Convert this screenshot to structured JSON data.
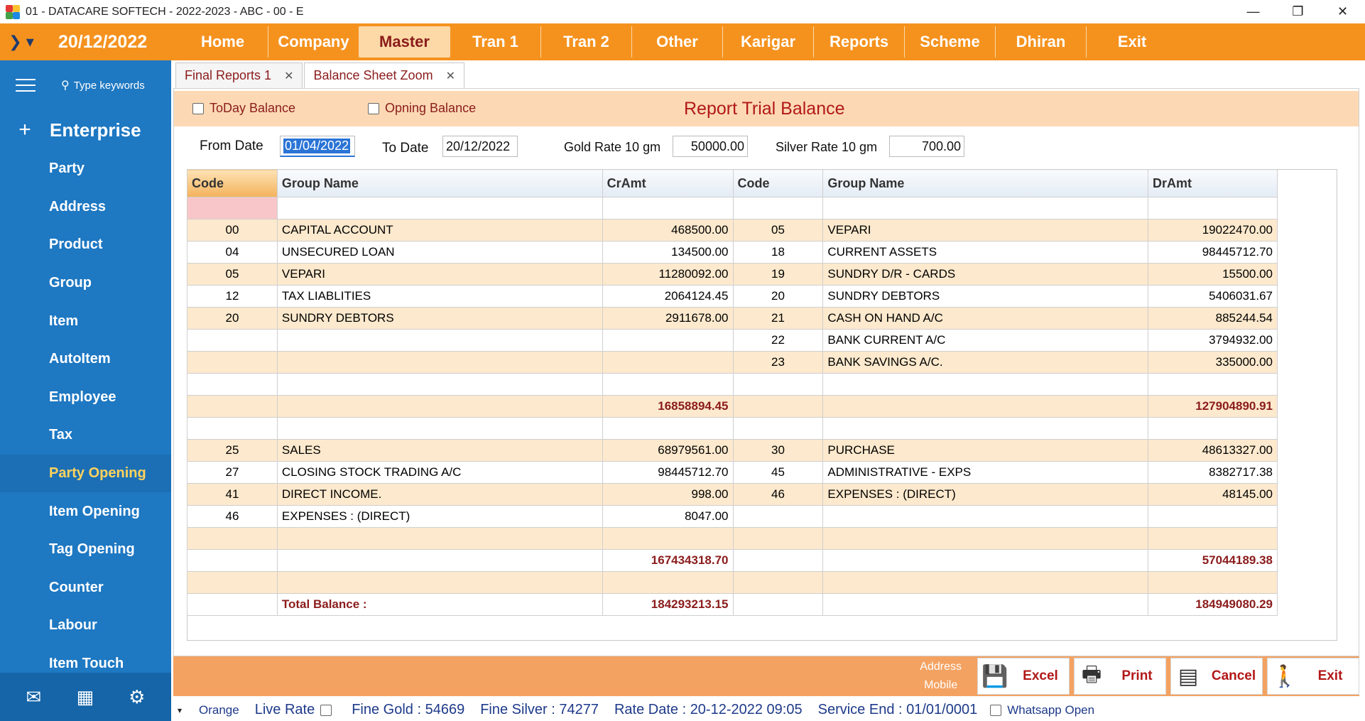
{
  "window": {
    "title": "01 - DATACARE SOFTECH - 2022-2023 - ABC - 00 - E",
    "min": "—",
    "restore": "❐",
    "close": "✕"
  },
  "menubar": {
    "toggle": "❯ ▾",
    "date": "20/12/2022",
    "items": [
      "Home",
      "Company",
      "Master",
      "Tran 1",
      "Tran 2",
      "Other",
      "Karigar",
      "Reports",
      "Scheme",
      "Dhiran",
      "Exit"
    ],
    "active": "Master"
  },
  "sidebar": {
    "search_placeholder": "Type keywords",
    "heading": "Enterprise",
    "plus": "+",
    "items": [
      "Party",
      "Address",
      "Product",
      "Group",
      "Item",
      "AutoItem",
      "Employee",
      "Tax",
      "Party Opening",
      "Item Opening",
      "Tag Opening",
      "Counter",
      "Labour",
      "Item Touch"
    ],
    "active": "Party Opening",
    "bottom_icons": [
      "mail-icon",
      "calendar-icon",
      "user-settings-icon"
    ]
  },
  "tabs": [
    {
      "label": "Final Reports 1",
      "close": "✕"
    },
    {
      "label": "Balance Sheet Zoom",
      "close": "✕"
    }
  ],
  "options": {
    "today_balance": "ToDay Balance",
    "opening_balance": "Opning Balance",
    "report_title": "Report Trial Balance"
  },
  "filters": {
    "from_date_label": "From Date",
    "from_date": "01/04/2022",
    "to_date_label": "To Date",
    "to_date": "20/12/2022",
    "gold_rate_label": "Gold Rate 10 gm",
    "gold_rate": "50000.00",
    "silver_rate_label": "Silver Rate 10 gm",
    "silver_rate": "700.00"
  },
  "grid": {
    "headers": [
      "Code",
      "Group Name",
      "CrAmt",
      "Code",
      "Group Name",
      "DrAmt"
    ],
    "rows": [
      {
        "cells": [
          "",
          "",
          "",
          "",
          "",
          ""
        ],
        "style": "plain",
        "first": true
      },
      {
        "cells": [
          "00",
          "CAPITAL ACCOUNT",
          "468500.00",
          "05",
          "VEPARI",
          "19022470.00"
        ],
        "style": "alt"
      },
      {
        "cells": [
          "04",
          "UNSECURED LOAN",
          "134500.00",
          "18",
          "CURRENT ASSETS",
          "98445712.70"
        ],
        "style": "plain"
      },
      {
        "cells": [
          "05",
          "VEPARI",
          "11280092.00",
          "19",
          "SUNDRY D/R - CARDS",
          "15500.00"
        ],
        "style": "alt"
      },
      {
        "cells": [
          "12",
          "TAX LIABLITIES",
          "2064124.45",
          "20",
          "SUNDRY DEBTORS",
          "5406031.67"
        ],
        "style": "plain"
      },
      {
        "cells": [
          "20",
          "SUNDRY DEBTORS",
          "2911678.00",
          "21",
          "CASH ON HAND A/C",
          "885244.54"
        ],
        "style": "alt"
      },
      {
        "cells": [
          "",
          "",
          "",
          "22",
          "BANK CURRENT A/C",
          "3794932.00"
        ],
        "style": "plain"
      },
      {
        "cells": [
          "",
          "",
          "",
          "23",
          "BANK SAVINGS A/C.",
          "335000.00"
        ],
        "style": "alt"
      },
      {
        "cells": [
          "",
          "",
          "",
          "",
          "",
          ""
        ],
        "style": "plain"
      },
      {
        "cells": [
          "",
          "",
          "16858894.45",
          "",
          "",
          "127904890.91"
        ],
        "style": "alt",
        "total": true
      },
      {
        "cells": [
          "",
          "",
          "",
          "",
          "",
          ""
        ],
        "style": "plain"
      },
      {
        "cells": [
          "25",
          "SALES",
          "68979561.00",
          "30",
          "PURCHASE",
          "48613327.00"
        ],
        "style": "alt"
      },
      {
        "cells": [
          "27",
          "CLOSING STOCK TRADING A/C",
          "98445712.70",
          "45",
          "ADMINISTRATIVE - EXPS",
          "8382717.38"
        ],
        "style": "plain"
      },
      {
        "cells": [
          "41",
          "DIRECT INCOME.",
          "998.00",
          "46",
          "EXPENSES : (DIRECT)",
          "48145.00"
        ],
        "style": "alt"
      },
      {
        "cells": [
          "46",
          "EXPENSES : (DIRECT)",
          "8047.00",
          "",
          "",
          ""
        ],
        "style": "plain"
      },
      {
        "cells": [
          "",
          "",
          "",
          "",
          "",
          ""
        ],
        "style": "alt"
      },
      {
        "cells": [
          "",
          "",
          "167434318.70",
          "",
          "",
          "57044189.38"
        ],
        "style": "plain",
        "total": true
      },
      {
        "cells": [
          "",
          "",
          "",
          "",
          "",
          ""
        ],
        "style": "alt"
      },
      {
        "cells": [
          "",
          "Total Balance :",
          "184293213.15",
          "",
          "",
          "184949080.29"
        ],
        "style": "plain",
        "total": true
      }
    ]
  },
  "footer": {
    "address": "Address",
    "mobile": "Mobile",
    "excel": "Excel",
    "print": "Print",
    "cancel": "Cancel",
    "exit": "Exit"
  },
  "status": {
    "dropdown": "▾",
    "theme": "Orange",
    "live_rate": "Live Rate",
    "fine_gold": "Fine Gold : 54669",
    "fine_silver": "Fine Silver : 74277",
    "rate_date": "Rate Date : 20-12-2022 09:05",
    "service_end": "Service End :  01/01/0001",
    "whatsapp": "Whatsapp Open"
  },
  "colors": {
    "menubar": "#f5921e",
    "sidebar": "#1e78c2",
    "active_sidebar_text": "#ffd35c",
    "accent_text": "#8b1c1c",
    "row_alt": "#fde9cd"
  }
}
